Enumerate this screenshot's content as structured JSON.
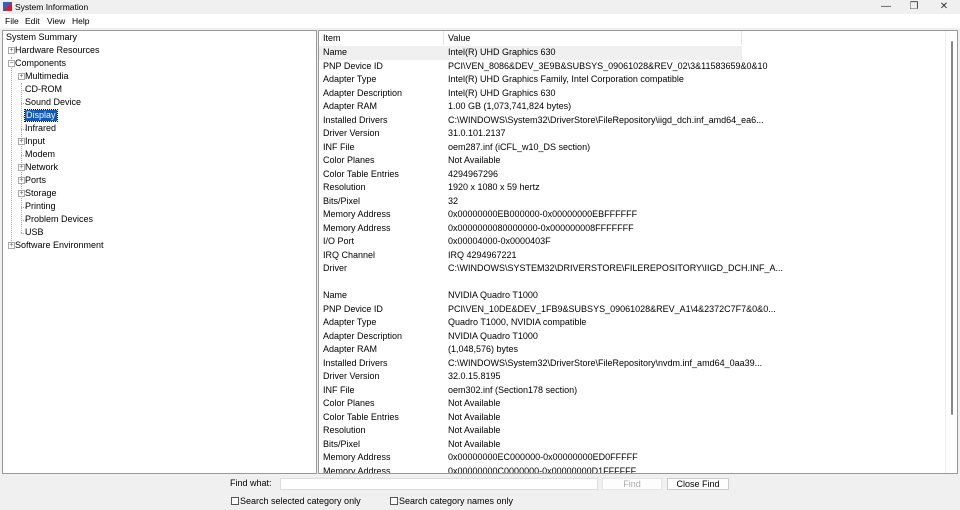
{
  "window": {
    "title": "System Information",
    "minimize": "—",
    "restore": "❐",
    "close": "✕"
  },
  "menu": [
    "File",
    "Edit",
    "View",
    "Help"
  ],
  "tree": [
    {
      "label": "System Summary",
      "level": 0,
      "expander": ""
    },
    {
      "label": "Hardware Resources",
      "level": 0,
      "expander": "+"
    },
    {
      "label": "Components",
      "level": 0,
      "expander": "-"
    },
    {
      "label": "Multimedia",
      "level": 1,
      "expander": "+"
    },
    {
      "label": "CD-ROM",
      "level": 1,
      "expander": ""
    },
    {
      "label": "Sound Device",
      "level": 1,
      "expander": ""
    },
    {
      "label": "Display",
      "level": 1,
      "expander": "",
      "selected": true
    },
    {
      "label": "Infrared",
      "level": 1,
      "expander": ""
    },
    {
      "label": "Input",
      "level": 1,
      "expander": "+"
    },
    {
      "label": "Modem",
      "level": 1,
      "expander": ""
    },
    {
      "label": "Network",
      "level": 1,
      "expander": "+"
    },
    {
      "label": "Ports",
      "level": 1,
      "expander": "+"
    },
    {
      "label": "Storage",
      "level": 1,
      "expander": "+"
    },
    {
      "label": "Printing",
      "level": 1,
      "expander": ""
    },
    {
      "label": "Problem Devices",
      "level": 1,
      "expander": ""
    },
    {
      "label": "USB",
      "level": 1,
      "expander": ""
    },
    {
      "label": "Software Environment",
      "level": 0,
      "expander": "+"
    }
  ],
  "columns": {
    "item": "Item",
    "value": "Value"
  },
  "rows": [
    [
      "Name",
      "Intel(R) UHD Graphics 630"
    ],
    [
      "PNP Device ID",
      "PCI\\VEN_8086&DEV_3E9B&SUBSYS_09061028&REV_02\\3&11583659&0&10"
    ],
    [
      "Adapter Type",
      "Intel(R) UHD Graphics Family, Intel Corporation compatible"
    ],
    [
      "Adapter Description",
      "Intel(R) UHD Graphics 630"
    ],
    [
      "Adapter RAM",
      "1.00 GB (1,073,741,824 bytes)"
    ],
    [
      "Installed Drivers",
      "C:\\WINDOWS\\System32\\DriverStore\\FileRepository\\iigd_dch.inf_amd64_ea6..."
    ],
    [
      "Driver Version",
      "31.0.101.2137"
    ],
    [
      "INF File",
      "oem287.inf (iCFL_w10_DS section)"
    ],
    [
      "Color Planes",
      "Not Available"
    ],
    [
      "Color Table Entries",
      "4294967296"
    ],
    [
      "Resolution",
      "1920 x 1080 x 59 hertz"
    ],
    [
      "Bits/Pixel",
      "32"
    ],
    [
      "Memory Address",
      "0x00000000EB000000-0x00000000EBFFFFFF"
    ],
    [
      "Memory Address",
      "0x0000000080000000-0x000000008FFFFFFF"
    ],
    [
      "I/O Port",
      "0x00004000-0x0000403F"
    ],
    [
      "IRQ Channel",
      "IRQ 4294967221"
    ],
    [
      "Driver",
      "C:\\WINDOWS\\SYSTEM32\\DRIVERSTORE\\FILEREPOSITORY\\IIGD_DCH.INF_A..."
    ],
    [
      "",
      ""
    ],
    [
      "Name",
      "NVIDIA Quadro T1000"
    ],
    [
      "PNP Device ID",
      "PCI\\VEN_10DE&DEV_1FB9&SUBSYS_09061028&REV_A1\\4&2372C7F7&0&0..."
    ],
    [
      "Adapter Type",
      "Quadro T1000, NVIDIA compatible"
    ],
    [
      "Adapter Description",
      "NVIDIA Quadro T1000"
    ],
    [
      "Adapter RAM",
      "(1,048,576) bytes"
    ],
    [
      "Installed Drivers",
      "C:\\WINDOWS\\System32\\DriverStore\\FileRepository\\nvdm.inf_amd64_0aa39..."
    ],
    [
      "Driver Version",
      "32.0.15.8195"
    ],
    [
      "INF File",
      "oem302.inf (Section178 section)"
    ],
    [
      "Color Planes",
      "Not Available"
    ],
    [
      "Color Table Entries",
      "Not Available"
    ],
    [
      "Resolution",
      "Not Available"
    ],
    [
      "Bits/Pixel",
      "Not Available"
    ],
    [
      "Memory Address",
      "0x00000000EC000000-0x00000000ED0FFFFF"
    ],
    [
      "Memory Address",
      "0x00000000C0000000-0x00000000D1FFFFFF"
    ]
  ],
  "find": {
    "label": "Find what:",
    "value": "",
    "find_button": "Find",
    "close_button": "Close Find",
    "opt1": "Search selected category only",
    "opt2": "Search category names only"
  }
}
